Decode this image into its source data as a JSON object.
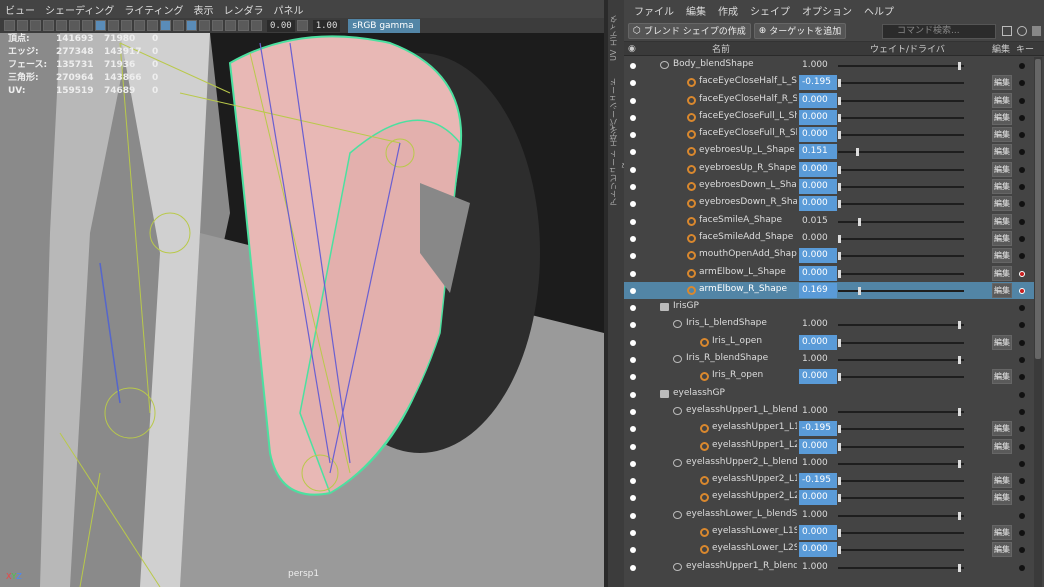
{
  "viewport": {
    "menu": [
      "ビュー",
      "シェーディング",
      "ライティング",
      "表示",
      "レンダラ",
      "パネル"
    ],
    "gamma": "0.00",
    "exposure": "1.00",
    "colorspace": "sRGB gamma",
    "hud": [
      {
        "label": "頂点:",
        "a": "141693",
        "b": "71980",
        "c": "0"
      },
      {
        "label": "エッジ:",
        "a": "277348",
        "b": "143917",
        "c": "0"
      },
      {
        "label": "フェース:",
        "a": "135731",
        "b": "71936",
        "c": "0"
      },
      {
        "label": "三角形:",
        "a": "270964",
        "b": "143866",
        "c": "0"
      },
      {
        "label": "UV:",
        "a": "159519",
        "b": "74689",
        "c": "0"
      }
    ],
    "camera": "persp1"
  },
  "sidetabs": [
    "UV エディタ",
    "ハイパーシェード",
    "アトリビュート エディタ"
  ],
  "panel": {
    "menu": [
      "ファイル",
      "編集",
      "作成",
      "シェイプ",
      "オプション",
      "ヘルプ"
    ],
    "create_label": "ブレンド シェイプの作成",
    "add_target_label": "ターゲットを追加",
    "search_placeholder": "コマンド検索...",
    "col_name": "名前",
    "col_weight": "ウェイト/ドライバ",
    "col_edit": "編集",
    "col_key": "キー",
    "edit_label": "編集",
    "rows": [
      {
        "type": "blend",
        "name": "Body_blendShape",
        "value": "1.000",
        "knob": 1.0,
        "indent": 0,
        "edit": false,
        "blue": false,
        "key": false
      },
      {
        "type": "target",
        "name": "faceEyeCloseHalf_L_Shape",
        "value": "-0.195",
        "knob": 0.0,
        "indent": 1,
        "edit": true,
        "blue": true,
        "key": false
      },
      {
        "type": "target",
        "name": "faceEyeCloseHalf_R_Shape",
        "value": "0.000",
        "knob": 0.0,
        "indent": 1,
        "edit": true,
        "blue": true,
        "key": false
      },
      {
        "type": "target",
        "name": "faceEyeCloseFull_L_Shape",
        "value": "0.000",
        "knob": 0.0,
        "indent": 1,
        "edit": true,
        "blue": true,
        "key": false
      },
      {
        "type": "target",
        "name": "faceEyeCloseFull_R_Shape",
        "value": "0.000",
        "knob": 0.0,
        "indent": 1,
        "edit": true,
        "blue": true,
        "key": false
      },
      {
        "type": "target",
        "name": "eyebroesUp_L_Shape",
        "value": "0.151",
        "knob": 0.151,
        "indent": 1,
        "edit": true,
        "blue": true,
        "key": false
      },
      {
        "type": "target",
        "name": "eyebroesUp_R_Shape",
        "value": "0.000",
        "knob": 0.0,
        "indent": 1,
        "edit": true,
        "blue": true,
        "key": false
      },
      {
        "type": "target",
        "name": "eyebroesDown_L_Shape",
        "value": "0.000",
        "knob": 0.0,
        "indent": 1,
        "edit": true,
        "blue": true,
        "key": false
      },
      {
        "type": "target",
        "name": "eyebroesDown_R_Shape",
        "value": "0.000",
        "knob": 0.0,
        "indent": 1,
        "edit": true,
        "blue": true,
        "key": false
      },
      {
        "type": "target",
        "name": "faceSmileA_Shape",
        "value": "0.015",
        "knob": 0.17,
        "indent": 1,
        "edit": true,
        "blue": false,
        "key": false
      },
      {
        "type": "target",
        "name": "faceSmileAdd_Shape",
        "value": "0.000",
        "knob": 0.0,
        "indent": 1,
        "edit": true,
        "blue": false,
        "key": false
      },
      {
        "type": "target",
        "name": "mouthOpenAdd_Shape",
        "value": "0.000",
        "knob": 0.0,
        "indent": 1,
        "edit": true,
        "blue": true,
        "key": false
      },
      {
        "type": "target",
        "name": "armElbow_L_Shape",
        "value": "0.000",
        "knob": 0.0,
        "indent": 1,
        "edit": true,
        "blue": true,
        "key": true
      },
      {
        "type": "target",
        "name": "armElbow_R_Shape",
        "value": "0.169",
        "knob": 0.169,
        "indent": 1,
        "edit": true,
        "blue": true,
        "key": true,
        "selected": true
      },
      {
        "type": "group",
        "name": "IrisGP",
        "value": "",
        "indent": 0,
        "edit": false,
        "blue": false,
        "key": false
      },
      {
        "type": "blend",
        "name": "Iris_L_blendShape",
        "value": "1.000",
        "knob": 1.0,
        "indent": 1,
        "edit": false,
        "blue": false,
        "key": false
      },
      {
        "type": "target",
        "name": "Iris_L_open",
        "value": "0.000",
        "knob": 0.0,
        "indent": 2,
        "edit": true,
        "blue": true,
        "key": false
      },
      {
        "type": "blend",
        "name": "Iris_R_blendShape",
        "value": "1.000",
        "knob": 1.0,
        "indent": 1,
        "edit": false,
        "blue": false,
        "key": false
      },
      {
        "type": "target",
        "name": "Iris_R_open",
        "value": "0.000",
        "knob": 0.0,
        "indent": 2,
        "edit": true,
        "blue": true,
        "key": false
      },
      {
        "type": "group",
        "name": "eyelasshGP",
        "value": "",
        "indent": 0,
        "edit": false,
        "blue": false,
        "key": false
      },
      {
        "type": "blend",
        "name": "eyelasshUpper1_L_blendShap",
        "value": "1.000",
        "knob": 1.0,
        "indent": 1,
        "edit": false,
        "blue": false,
        "key": false
      },
      {
        "type": "target",
        "name": "eyelasshUpper1_L1Shape",
        "value": "-0.195",
        "knob": 0.0,
        "indent": 2,
        "edit": true,
        "blue": true,
        "key": false
      },
      {
        "type": "target",
        "name": "eyelasshUpper1_L2Shape",
        "value": "0.000",
        "knob": 0.0,
        "indent": 2,
        "edit": true,
        "blue": true,
        "key": false
      },
      {
        "type": "blend",
        "name": "eyelasshUpper2_L_blendShap",
        "value": "1.000",
        "knob": 1.0,
        "indent": 1,
        "edit": false,
        "blue": false,
        "key": false
      },
      {
        "type": "target",
        "name": "eyelasshUpper2_L1Shape",
        "value": "-0.195",
        "knob": 0.0,
        "indent": 2,
        "edit": true,
        "blue": true,
        "key": false
      },
      {
        "type": "target",
        "name": "eyelasshUpper2_L2Shape",
        "value": "0.000",
        "knob": 0.0,
        "indent": 2,
        "edit": true,
        "blue": true,
        "key": false
      },
      {
        "type": "blend",
        "name": "eyelasshLower_L_blendShap",
        "value": "1.000",
        "knob": 1.0,
        "indent": 1,
        "edit": false,
        "blue": false,
        "key": false
      },
      {
        "type": "target",
        "name": "eyelasshLower_L1Shape",
        "value": "0.000",
        "knob": 0.0,
        "indent": 2,
        "edit": true,
        "blue": true,
        "key": false
      },
      {
        "type": "target",
        "name": "eyelasshLower_L2Shape",
        "value": "0.000",
        "knob": 0.0,
        "indent": 2,
        "edit": true,
        "blue": true,
        "key": false
      },
      {
        "type": "blend",
        "name": "eyelasshUpper1_R_blendShap",
        "value": "1.000",
        "knob": 1.0,
        "indent": 1,
        "edit": false,
        "blue": false,
        "key": false
      }
    ]
  }
}
